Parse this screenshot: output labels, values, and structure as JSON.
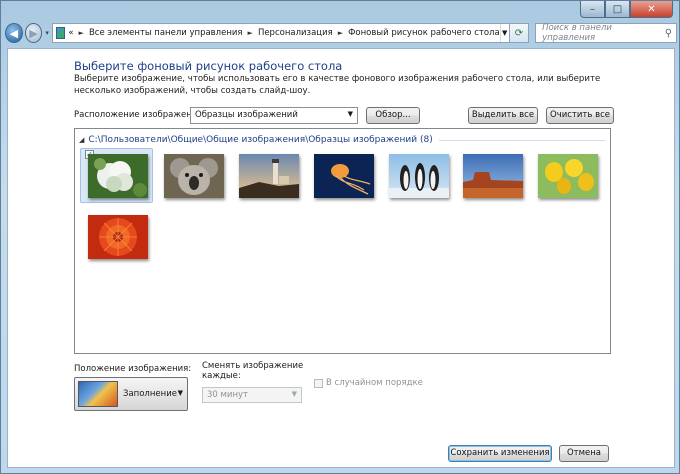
{
  "window": {
    "caption_buttons": {
      "minimize": "–",
      "maximize": "□",
      "close": "✕"
    }
  },
  "nav": {
    "back_icon": "back-arrow-icon",
    "forward_icon": "forward-arrow-icon",
    "history_glyph": "▾",
    "address": {
      "prefix": "«",
      "crumbs": [
        "Все элементы панели управления",
        "Персонализация",
        "Фоновый рисунок рабочего стола"
      ],
      "separator": "►"
    },
    "search_placeholder": "Поиск в панели управления"
  },
  "main": {
    "heading": "Выберите фоновый рисунок рабочего стола",
    "description": "Выберите изображение, чтобы использовать его в качестве фонового изображения рабочего стола, или выберите несколько изображений, чтобы создать слайд-шоу.",
    "location_label": "Расположение изображения:",
    "location_value": "Образцы изображений",
    "browse_label": "Обзор...",
    "select_all_label": "Выделить все",
    "clear_all_label": "Очистить все",
    "group_title": "C:\\Пользователи\\Общие\\Общие изображения\\Образцы изображений (8)",
    "images": [
      {
        "name": "Hydrangeas",
        "selected": true
      },
      {
        "name": "Koala",
        "selected": false
      },
      {
        "name": "Lighthouse",
        "selected": false
      },
      {
        "name": "Jellyfish",
        "selected": false
      },
      {
        "name": "Penguins",
        "selected": false
      },
      {
        "name": "Desert",
        "selected": false
      },
      {
        "name": "Tulips",
        "selected": false
      },
      {
        "name": "Chrysanthemum",
        "selected": false
      }
    ]
  },
  "bottom": {
    "position_label": "Положение изображения:",
    "position_value": "Заполнение",
    "change_label": "Сменять изображение каждые:",
    "interval_value": "30 минут",
    "shuffle_label": "В случайном порядке",
    "save_label": "Сохранить изменения",
    "cancel_label": "Отмена"
  }
}
